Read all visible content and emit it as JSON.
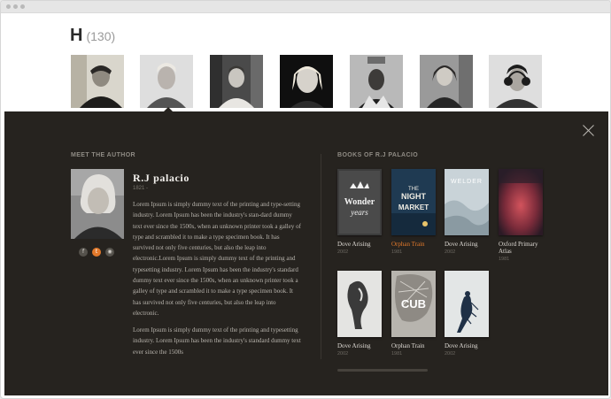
{
  "letter_header": {
    "letter": "H",
    "count": "(130)"
  },
  "authors_row": [
    {
      "name": "author-thumb-1"
    },
    {
      "name": "author-thumb-2"
    },
    {
      "name": "author-thumb-3"
    },
    {
      "name": "author-thumb-4"
    },
    {
      "name": "author-thumb-5"
    },
    {
      "name": "author-thumb-6"
    },
    {
      "name": "author-thumb-7"
    }
  ],
  "author_panel": {
    "section_label": "MEET THE AUTHOR",
    "name": "R.J palacio",
    "year": "1821 -",
    "bio_paragraphs": [
      "Lorem Ipsum is simply dummy text of the printing and type-setting industry. Lorem Ipsum has been the industry's stan-dard dummy text ever since the 1500s, when an unknown printer took a galley of type and scrambled it to make a type specimen book. It has survived not only five centuries, but also the leap into electronic.Lorem Ipsum is simply dummy text of the printing and typesetting industry. Lorem Ipsum has been the industry's standard dummy text ever since the 1500s, when an unknown printer took a galley of type and scrambled it to make a type specimen book. It has survived not only five centuries, but also the leap into electronic.",
      "Lorem Ipsum is simply dummy text of the printing and typesetting industry. Lorem Ipsum has been the industry's standard dummy text ever since the 1500s"
    ],
    "social": [
      {
        "icon": "facebook-icon",
        "glyph": "f"
      },
      {
        "icon": "twitter-icon",
        "glyph": "t"
      },
      {
        "icon": "rss-icon",
        "glyph": "◉"
      }
    ]
  },
  "books_panel": {
    "section_label": "BOOKS OF R.J PALACIO",
    "books": [
      {
        "title": "Dove Arising",
        "year": "2002",
        "cover_text": "WONDER\nyears",
        "highlight": false
      },
      {
        "title": "Orphan Train",
        "year": "1981",
        "cover_text": "THE NIGHT MARKET",
        "highlight": true
      },
      {
        "title": "Dove Arising",
        "year": "2002",
        "cover_text": "WELDER",
        "highlight": false
      },
      {
        "title": "Oxford Primary Atlas",
        "year": "1981",
        "cover_text": "",
        "highlight": false
      },
      {
        "title": "Dove Arising",
        "year": "2002",
        "cover_text": "",
        "highlight": false
      },
      {
        "title": "Orphan Train",
        "year": "1981",
        "cover_text": "CUB",
        "highlight": false
      },
      {
        "title": "Dove Arising",
        "year": "2002",
        "cover_text": "",
        "highlight": false
      }
    ]
  },
  "colors": {
    "panel_bg": "#26231f",
    "accent": "#e2792b"
  }
}
